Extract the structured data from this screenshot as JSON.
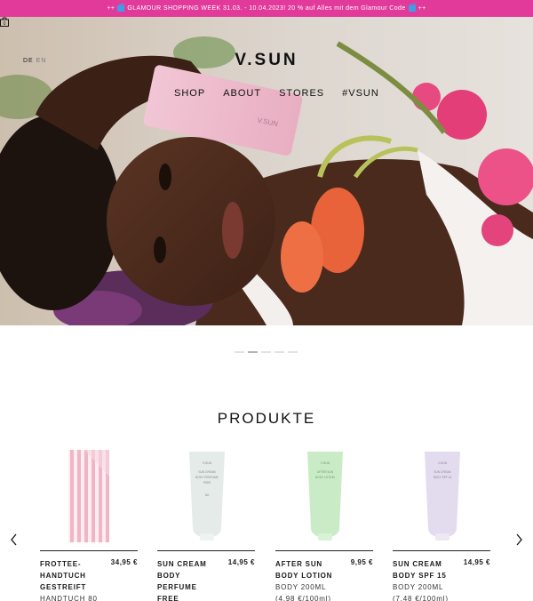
{
  "promo": {
    "left": "++",
    "text": "GLAMOUR SHOPPING WEEK 31.03. - 10.04.2023! 20 % auf Alles mit dem Glamour Code",
    "right": "++"
  },
  "header": {
    "lang_de": "DE",
    "lang_en": "EN",
    "logo": "V.SUN",
    "nav": [
      "SHOP",
      "ABOUT",
      "STORES",
      "#VSUN"
    ]
  },
  "hero_tube_text": "V.SUN",
  "carousel": {
    "slides": 5,
    "active": 2
  },
  "section_title": "PRODUKTE",
  "products": [
    {
      "name": "FROTTEE-HANDTUCH GESTREIFT",
      "price": "34,95 €",
      "sub1": "HANDTUCH 80",
      "sub2": ""
    },
    {
      "name": "SUN CREAM BODY PERFUME FREE",
      "price": "14,95 €",
      "sub1": "",
      "sub2": ""
    },
    {
      "name": "AFTER SUN BODY LOTION",
      "price": "9,95 €",
      "sub1": "BODY 200ML",
      "sub2": "(4,98 €/100ml)"
    },
    {
      "name": "SUN CREAM BODY SPF 15",
      "price": "14,95 €",
      "sub1": "BODY 200ML",
      "sub2": "(7,48 €/100ml)"
    }
  ],
  "product_tube_labels": {
    "p2": [
      "V.SUN",
      "SUN CREAM",
      "BODY PERFUME",
      "FREE",
      "50"
    ],
    "p3": [
      "V.SUN",
      "AFTER SUN",
      "BODY LOTION"
    ],
    "p4": [
      "V.SUN",
      "SUN CREAM",
      "BODY SPF 15"
    ]
  },
  "colors": {
    "promo_bg": "#e23a9a",
    "text": "#111111"
  }
}
